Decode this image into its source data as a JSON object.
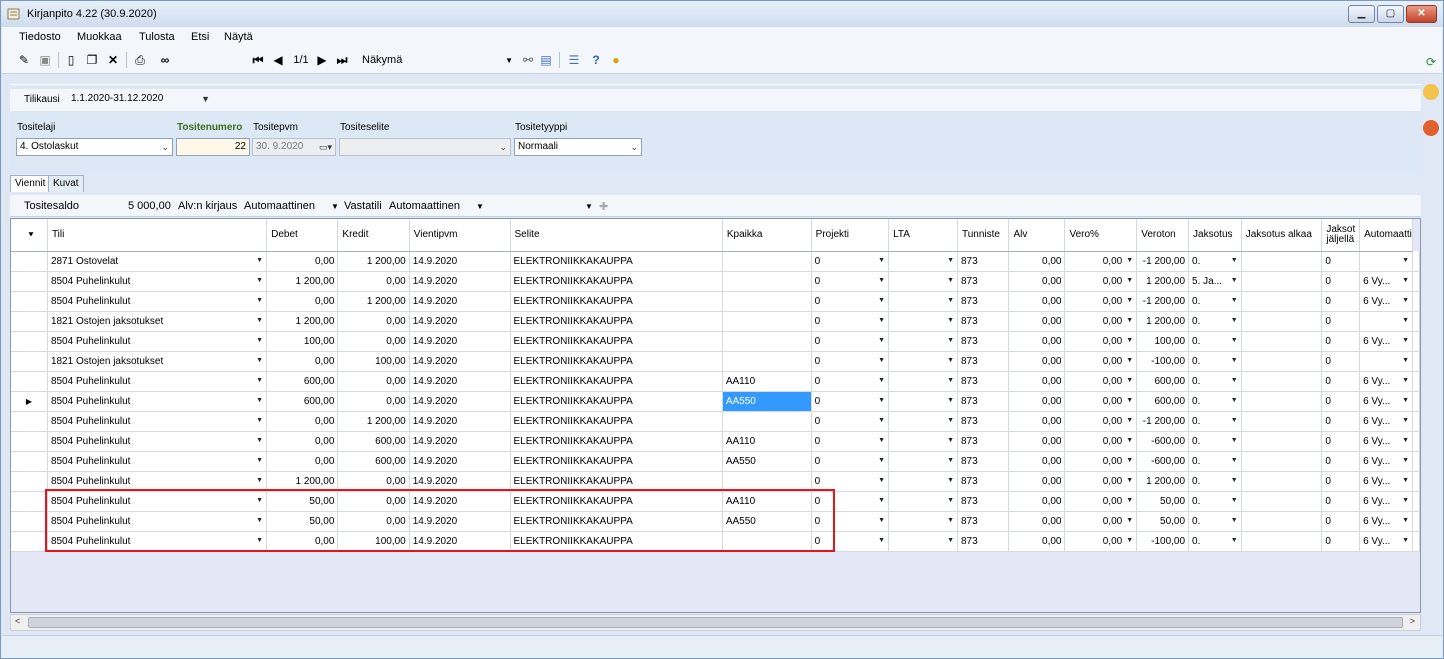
{
  "window": {
    "title": "Kirjanpito 4.22  (30.9.2020)"
  },
  "menu": [
    "Tiedosto",
    "Muokkaa",
    "Tulosta",
    "Etsi",
    "Näytä"
  ],
  "toolbar": {
    "page_indicator": "1/1",
    "view_select": "Näkymä"
  },
  "header": {
    "tilikausi_label": "Tilikausi",
    "tilikausi_value": "1.1.2020-31.12.2020",
    "tositelaji_label": "Tositelaji",
    "tositelaji_value": "4. Ostolaskut",
    "tositenumero_label": "Tositenumero",
    "tositenumero_value": "22",
    "tositepvm_label": "Tositepvm",
    "tositepvm_value": "30.  9.2020",
    "tositeselite_label": "Tositeselite",
    "tositeselite_value": "",
    "tositetyyppi_label": "Tositetyyppi",
    "tositetyyppi_value": "Normaali"
  },
  "tabs": [
    "Viennit",
    "Kuvat"
  ],
  "summary": {
    "tositesaldo_label": "Tositesaldo",
    "tositesaldo_value": "5 000,00",
    "alv_label": "Alv:n kirjaus",
    "alv_value": "Automaattinen",
    "vastatili_label": "Vastatili",
    "vastatili_value": "Automaattinen"
  },
  "grid": {
    "columns": [
      "Tili",
      "Debet",
      "Kredit",
      "Vientipvm",
      "Selite",
      "Kpaikka",
      "Projekti",
      "LTA",
      "Tunniste",
      "Alv",
      "Vero%",
      "Veroton",
      "Jaksotus",
      "Jaksotus alkaa",
      "Jaksot jäljellä",
      "Automaatti"
    ],
    "rows": [
      {
        "tili": "2871 Ostovelat",
        "debet": "0,00",
        "kredit": "1 200,00",
        "pvm": "14.9.2020",
        "selite": "ELEKTRONIIKKAKAUPPA",
        "kpaikka": "",
        "projekti": "0",
        "lta": "",
        "tunniste": "873",
        "alv": "0,00",
        "vero": "0,00",
        "veroton": "-1 200,00",
        "jaksotus": "0.",
        "alkaa": "",
        "jaljella": "0",
        "auto": "",
        "current": ""
      },
      {
        "tili": "8504 Puhelinkulut",
        "debet": "1 200,00",
        "kredit": "0,00",
        "pvm": "14.9.2020",
        "selite": "ELEKTRONIIKKAKAUPPA",
        "kpaikka": "",
        "projekti": "0",
        "lta": "",
        "tunniste": "873",
        "alv": "0,00",
        "vero": "0,00",
        "veroton": "1 200,00",
        "jaksotus": "5. Ja...",
        "alkaa": "",
        "jaljella": "0",
        "auto": "6 Vy...",
        "current": ""
      },
      {
        "tili": "8504 Puhelinkulut",
        "debet": "0,00",
        "kredit": "1 200,00",
        "pvm": "14.9.2020",
        "selite": "ELEKTRONIIKKAKAUPPA",
        "kpaikka": "",
        "projekti": "0",
        "lta": "",
        "tunniste": "873",
        "alv": "0,00",
        "vero": "0,00",
        "veroton": "-1 200,00",
        "jaksotus": "0.",
        "alkaa": "",
        "jaljella": "0",
        "auto": "6 Vy...",
        "current": ""
      },
      {
        "tili": "1821 Ostojen jaksotukset",
        "debet": "1 200,00",
        "kredit": "0,00",
        "pvm": "14.9.2020",
        "selite": "ELEKTRONIIKKAKAUPPA",
        "kpaikka": "",
        "projekti": "0",
        "lta": "",
        "tunniste": "873",
        "alv": "0,00",
        "vero": "0,00",
        "veroton": "1 200,00",
        "jaksotus": "0.",
        "alkaa": "",
        "jaljella": "0",
        "auto": "",
        "current": ""
      },
      {
        "tili": "8504 Puhelinkulut",
        "debet": "100,00",
        "kredit": "0,00",
        "pvm": "14.9.2020",
        "selite": "ELEKTRONIIKKAKAUPPA",
        "kpaikka": "",
        "projekti": "0",
        "lta": "",
        "tunniste": "873",
        "alv": "0,00",
        "vero": "0,00",
        "veroton": "100,00",
        "jaksotus": "0.",
        "alkaa": "",
        "jaljella": "0",
        "auto": "6 Vy...",
        "current": ""
      },
      {
        "tili": "1821 Ostojen jaksotukset",
        "debet": "0,00",
        "kredit": "100,00",
        "pvm": "14.9.2020",
        "selite": "ELEKTRONIIKKAKAUPPA",
        "kpaikka": "",
        "projekti": "0",
        "lta": "",
        "tunniste": "873",
        "alv": "0,00",
        "vero": "0,00",
        "veroton": "-100,00",
        "jaksotus": "0.",
        "alkaa": "",
        "jaljella": "0",
        "auto": "",
        "current": ""
      },
      {
        "tili": "8504 Puhelinkulut",
        "debet": "600,00",
        "kredit": "0,00",
        "pvm": "14.9.2020",
        "selite": "ELEKTRONIIKKAKAUPPA",
        "kpaikka": "AA110",
        "projekti": "0",
        "lta": "",
        "tunniste": "873",
        "alv": "0,00",
        "vero": "0,00",
        "veroton": "600,00",
        "jaksotus": "0.",
        "alkaa": "",
        "jaljella": "0",
        "auto": "6 Vy...",
        "current": ""
      },
      {
        "tili": "8504 Puhelinkulut",
        "debet": "600,00",
        "kredit": "0,00",
        "pvm": "14.9.2020",
        "selite": "ELEKTRONIIKKAKAUPPA",
        "kpaikka": "AA550",
        "projekti": "0",
        "lta": "",
        "tunniste": "873",
        "alv": "0,00",
        "vero": "0,00",
        "veroton": "600,00",
        "jaksotus": "0.",
        "alkaa": "",
        "jaljella": "0",
        "auto": "6 Vy...",
        "current": "▶"
      },
      {
        "tili": "8504 Puhelinkulut",
        "debet": "0,00",
        "kredit": "1 200,00",
        "pvm": "14.9.2020",
        "selite": "ELEKTRONIIKKAKAUPPA",
        "kpaikka": "",
        "projekti": "0",
        "lta": "",
        "tunniste": "873",
        "alv": "0,00",
        "vero": "0,00",
        "veroton": "-1 200,00",
        "jaksotus": "0.",
        "alkaa": "",
        "jaljella": "0",
        "auto": "6 Vy...",
        "current": ""
      },
      {
        "tili": "8504 Puhelinkulut",
        "debet": "0,00",
        "kredit": "600,00",
        "pvm": "14.9.2020",
        "selite": "ELEKTRONIIKKAKAUPPA",
        "kpaikka": "AA110",
        "projekti": "0",
        "lta": "",
        "tunniste": "873",
        "alv": "0,00",
        "vero": "0,00",
        "veroton": "-600,00",
        "jaksotus": "0.",
        "alkaa": "",
        "jaljella": "0",
        "auto": "6 Vy...",
        "current": ""
      },
      {
        "tili": "8504 Puhelinkulut",
        "debet": "0,00",
        "kredit": "600,00",
        "pvm": "14.9.2020",
        "selite": "ELEKTRONIIKKAKAUPPA",
        "kpaikka": "AA550",
        "projekti": "0",
        "lta": "",
        "tunniste": "873",
        "alv": "0,00",
        "vero": "0,00",
        "veroton": "-600,00",
        "jaksotus": "0.",
        "alkaa": "",
        "jaljella": "0",
        "auto": "6 Vy...",
        "current": ""
      },
      {
        "tili": "8504 Puhelinkulut",
        "debet": "1 200,00",
        "kredit": "0,00",
        "pvm": "14.9.2020",
        "selite": "ELEKTRONIIKKAKAUPPA",
        "kpaikka": "",
        "projekti": "0",
        "lta": "",
        "tunniste": "873",
        "alv": "0,00",
        "vero": "0,00",
        "veroton": "1 200,00",
        "jaksotus": "0.",
        "alkaa": "",
        "jaljella": "0",
        "auto": "6 Vy...",
        "current": ""
      },
      {
        "tili": "8504 Puhelinkulut",
        "debet": "50,00",
        "kredit": "0,00",
        "pvm": "14.9.2020",
        "selite": "ELEKTRONIIKKAKAUPPA",
        "kpaikka": "AA110",
        "projekti": "0",
        "lta": "",
        "tunniste": "873",
        "alv": "0,00",
        "vero": "0,00",
        "veroton": "50,00",
        "jaksotus": "0.",
        "alkaa": "",
        "jaljella": "0",
        "auto": "6 Vy...",
        "current": ""
      },
      {
        "tili": "8504 Puhelinkulut",
        "debet": "50,00",
        "kredit": "0,00",
        "pvm": "14.9.2020",
        "selite": "ELEKTRONIIKKAKAUPPA",
        "kpaikka": "AA550",
        "projekti": "0",
        "lta": "",
        "tunniste": "873",
        "alv": "0,00",
        "vero": "0,00",
        "veroton": "50,00",
        "jaksotus": "0.",
        "alkaa": "",
        "jaljella": "0",
        "auto": "6 Vy...",
        "current": ""
      },
      {
        "tili": "8504 Puhelinkulut",
        "debet": "0,00",
        "kredit": "100,00",
        "pvm": "14.9.2020",
        "selite": "ELEKTRONIIKKAKAUPPA",
        "kpaikka": "",
        "projekti": "0",
        "lta": "",
        "tunniste": "873",
        "alv": "0,00",
        "vero": "0,00",
        "veroton": "-100,00",
        "jaksotus": "0.",
        "alkaa": "",
        "jaljella": "0",
        "auto": "6 Vy...",
        "current": ""
      }
    ]
  },
  "colors": {
    "accent": "#3399ff",
    "highlight_border": "#e8141b",
    "label_green": "#3e6d1e"
  }
}
